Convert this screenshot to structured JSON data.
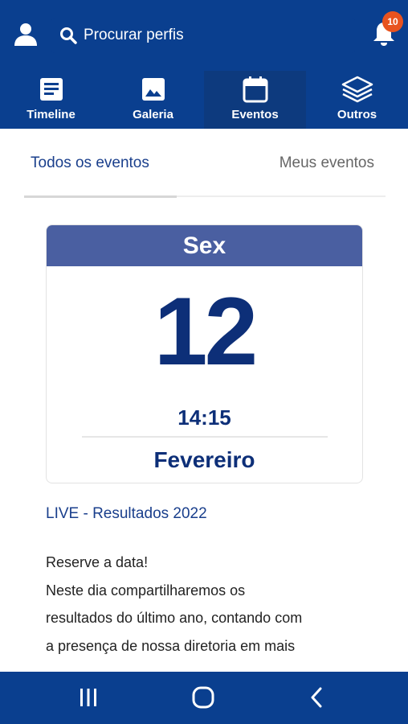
{
  "search": {
    "placeholder": "Procurar perfis"
  },
  "notifications": {
    "count": "10"
  },
  "tabs": [
    {
      "label": "Timeline",
      "icon": "article-icon"
    },
    {
      "label": "Galeria",
      "icon": "image-icon"
    },
    {
      "label": "Eventos",
      "icon": "calendar-icon",
      "active": true
    },
    {
      "label": "Outros",
      "icon": "layers-icon"
    }
  ],
  "segments": {
    "all": "Todos os eventos",
    "mine": "Meus eventos"
  },
  "event": {
    "weekday": "Sex",
    "day": "12",
    "time": "14:15",
    "month": "Fevereiro",
    "title": "LIVE - Resultados 2022",
    "description_lines": [
      "Reserve a data!",
      "Neste dia compartilharemos os",
      "resultados do último ano, contando com",
      "a presença de nossa diretoria em mais"
    ]
  },
  "colors": {
    "primary": "#0a3f8f",
    "card_header": "#4a5fa1",
    "badge": "#e8531f",
    "text_dark_blue": "#0d2f78"
  }
}
